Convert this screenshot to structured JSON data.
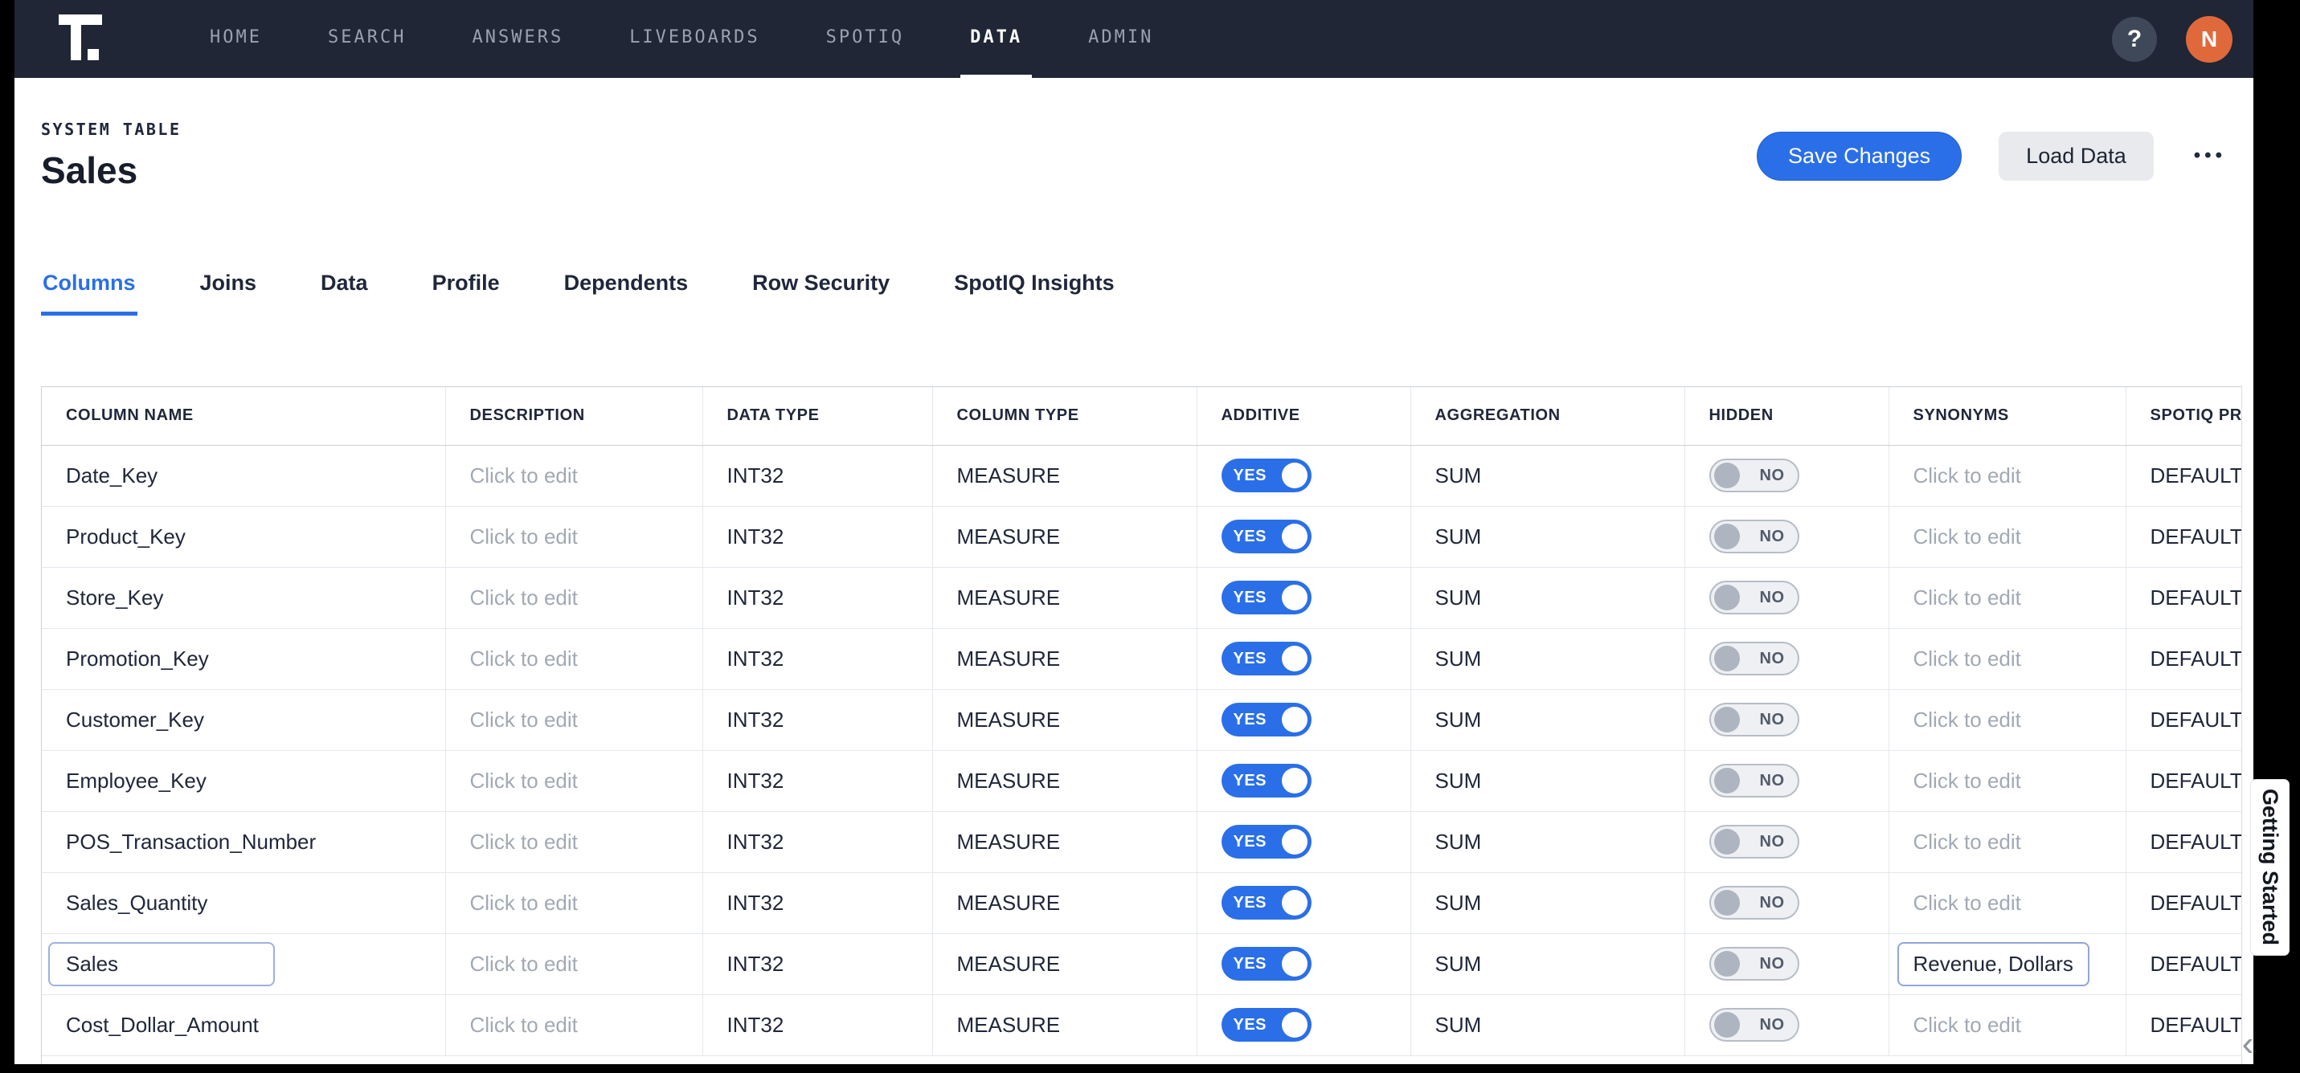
{
  "nav": {
    "logo": "thoughtspot-logo",
    "items": [
      {
        "label": "HOME",
        "active": false
      },
      {
        "label": "SEARCH",
        "active": false
      },
      {
        "label": "ANSWERS",
        "active": false
      },
      {
        "label": "LIVEBOARDS",
        "active": false
      },
      {
        "label": "SPOTIQ",
        "active": false
      },
      {
        "label": "DATA",
        "active": true
      },
      {
        "label": "ADMIN",
        "active": false
      }
    ],
    "help_label": "?",
    "avatar_initial": "N"
  },
  "header": {
    "eyebrow": "SYSTEM TABLE",
    "title": "Sales",
    "buttons": {
      "save": "Save Changes",
      "load": "Load Data",
      "more": "•••"
    }
  },
  "tabs": [
    {
      "label": "Columns",
      "active": true
    },
    {
      "label": "Joins",
      "active": false
    },
    {
      "label": "Data",
      "active": false
    },
    {
      "label": "Profile",
      "active": false
    },
    {
      "label": "Dependents",
      "active": false
    },
    {
      "label": "Row Security",
      "active": false
    },
    {
      "label": "SpotIQ Insights",
      "active": false
    }
  ],
  "table": {
    "headers": [
      "COLUMN NAME",
      "DESCRIPTION",
      "DATA TYPE",
      "COLUMN TYPE",
      "ADDITIVE",
      "AGGREGATION",
      "HIDDEN",
      "SYNONYMS",
      "SPOTIQ PREFERENCE"
    ],
    "placeholder": "Click to edit",
    "rows": [
      {
        "name": "Date_Key",
        "description": "Click to edit",
        "data_type": "INT32",
        "column_type": "MEASURE",
        "additive": "YES",
        "aggregation": "SUM",
        "hidden": "NO",
        "synonyms": "Click to edit",
        "spotiq_preference": "DEFAULT",
        "selected": false
      },
      {
        "name": "Product_Key",
        "description": "Click to edit",
        "data_type": "INT32",
        "column_type": "MEASURE",
        "additive": "YES",
        "aggregation": "SUM",
        "hidden": "NO",
        "synonyms": "Click to edit",
        "spotiq_preference": "DEFAULT",
        "selected": false
      },
      {
        "name": "Store_Key",
        "description": "Click to edit",
        "data_type": "INT32",
        "column_type": "MEASURE",
        "additive": "YES",
        "aggregation": "SUM",
        "hidden": "NO",
        "synonyms": "Click to edit",
        "spotiq_preference": "DEFAULT",
        "selected": false
      },
      {
        "name": "Promotion_Key",
        "description": "Click to edit",
        "data_type": "INT32",
        "column_type": "MEASURE",
        "additive": "YES",
        "aggregation": "SUM",
        "hidden": "NO",
        "synonyms": "Click to edit",
        "spotiq_preference": "DEFAULT",
        "selected": false
      },
      {
        "name": "Customer_Key",
        "description": "Click to edit",
        "data_type": "INT32",
        "column_type": "MEASURE",
        "additive": "YES",
        "aggregation": "SUM",
        "hidden": "NO",
        "synonyms": "Click to edit",
        "spotiq_preference": "DEFAULT",
        "selected": false
      },
      {
        "name": "Employee_Key",
        "description": "Click to edit",
        "data_type": "INT32",
        "column_type": "MEASURE",
        "additive": "YES",
        "aggregation": "SUM",
        "hidden": "NO",
        "synonyms": "Click to edit",
        "spotiq_preference": "DEFAULT",
        "selected": false
      },
      {
        "name": "POS_Transaction_Number",
        "description": "Click to edit",
        "data_type": "INT32",
        "column_type": "MEASURE",
        "additive": "YES",
        "aggregation": "SUM",
        "hidden": "NO",
        "synonyms": "Click to edit",
        "spotiq_preference": "DEFAULT",
        "selected": false
      },
      {
        "name": "Sales_Quantity",
        "description": "Click to edit",
        "data_type": "INT32",
        "column_type": "MEASURE",
        "additive": "YES",
        "aggregation": "SUM",
        "hidden": "NO",
        "synonyms": "Click to edit",
        "spotiq_preference": "DEFAULT",
        "selected": false
      },
      {
        "name": "Sales",
        "description": "Click to edit",
        "data_type": "INT32",
        "column_type": "MEASURE",
        "additive": "YES",
        "aggregation": "SUM",
        "hidden": "NO",
        "synonyms": "Revenue, Dollars",
        "spotiq_preference": "DEFAULT",
        "selected": true
      },
      {
        "name": "Cost_Dollar_Amount",
        "description": "Click to edit",
        "data_type": "INT32",
        "column_type": "MEASURE",
        "additive": "YES",
        "aggregation": "SUM",
        "hidden": "NO",
        "synonyms": "Click to edit",
        "spotiq_preference": "DEFAULT",
        "selected": false
      }
    ]
  },
  "side_panel": {
    "getting_started_label": "Getting Started",
    "collapse_icon": "‹"
  },
  "colors": {
    "accent_blue": "#2a6fe8",
    "navbar_bg": "#202635",
    "avatar_orange": "#e0693c"
  }
}
